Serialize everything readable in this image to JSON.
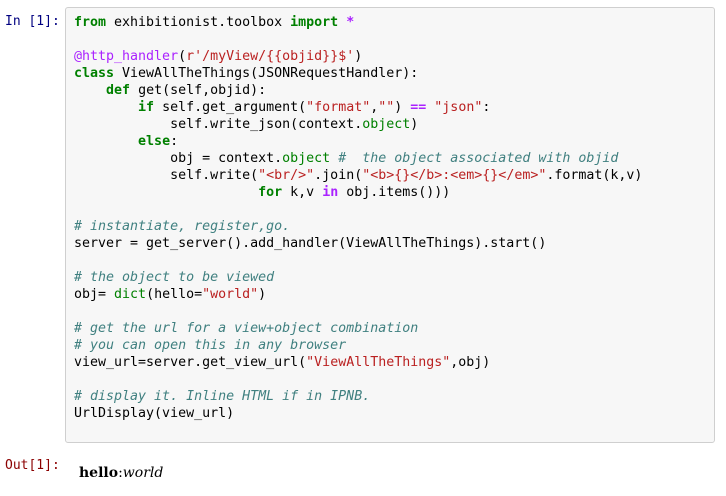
{
  "cell": {
    "in_prompt": "In [1]:",
    "out_prompt": "Out[1]:",
    "code_lines": [
      [
        [
          "kw",
          "from"
        ],
        [
          "plain",
          " exhibitionist.toolbox "
        ],
        [
          "kw",
          "import"
        ],
        [
          "plain",
          " "
        ],
        [
          "op",
          "*"
        ]
      ],
      [],
      [
        [
          "dec",
          "@http_handler"
        ],
        [
          "plain",
          "("
        ],
        [
          "str",
          "r'/myView/{{objid}}$'"
        ],
        [
          "plain",
          ")"
        ]
      ],
      [
        [
          "kw",
          "class"
        ],
        [
          "plain",
          " ViewAllTheThings(JSONRequestHandler):"
        ]
      ],
      [
        [
          "plain",
          "    "
        ],
        [
          "kw",
          "def"
        ],
        [
          "plain",
          " get(self,objid):"
        ]
      ],
      [
        [
          "plain",
          "        "
        ],
        [
          "kw",
          "if"
        ],
        [
          "plain",
          " self.get_argument("
        ],
        [
          "str",
          "\"format\""
        ],
        [
          "plain",
          ","
        ],
        [
          "str",
          "\"\""
        ],
        [
          "plain",
          ") "
        ],
        [
          "op",
          "=="
        ],
        [
          "plain",
          " "
        ],
        [
          "str",
          "\"json\""
        ],
        [
          "plain",
          ":"
        ]
      ],
      [
        [
          "plain",
          "            self.write_json(context."
        ],
        [
          "kwn",
          "object"
        ],
        [
          "plain",
          ")"
        ]
      ],
      [
        [
          "plain",
          "        "
        ],
        [
          "kw",
          "else"
        ],
        [
          "plain",
          ":"
        ]
      ],
      [
        [
          "plain",
          "            obj = context."
        ],
        [
          "kwn",
          "object"
        ],
        [
          "plain",
          " "
        ],
        [
          "cm",
          "#  the object associated with objid"
        ]
      ],
      [
        [
          "plain",
          "            self.write("
        ],
        [
          "str",
          "\"<br/>\""
        ],
        [
          "plain",
          ".join("
        ],
        [
          "str",
          "\"<b>{}</b>:<em>{}</em>\""
        ],
        [
          "plain",
          ".format(k,v)"
        ]
      ],
      [
        [
          "plain",
          "                       "
        ],
        [
          "kw",
          "for"
        ],
        [
          "plain",
          " k,v "
        ],
        [
          "op",
          "in"
        ],
        [
          "plain",
          " obj.items()))"
        ]
      ],
      [],
      [
        [
          "cm",
          "# instantiate, register,go."
        ]
      ],
      [
        [
          "plain",
          "server = get_server().add_handler(ViewAllTheThings).start()"
        ]
      ],
      [],
      [
        [
          "cm",
          "# the object to be viewed"
        ]
      ],
      [
        [
          "plain",
          "obj= "
        ],
        [
          "bi",
          "dict"
        ],
        [
          "plain",
          "(hello="
        ],
        [
          "str",
          "\"world\""
        ],
        [
          "plain",
          ")"
        ]
      ],
      [],
      [
        [
          "cm",
          "# get the url for a view+object combination"
        ]
      ],
      [
        [
          "cm",
          "# you can open this in any browser"
        ]
      ],
      [
        [
          "plain",
          "view_url=server.get_view_url("
        ],
        [
          "str",
          "\"ViewAllTheThings\""
        ],
        [
          "plain",
          ",obj)"
        ]
      ],
      [],
      [
        [
          "cm",
          "# display it. Inline HTML if in IPNB."
        ]
      ],
      [
        [
          "plain",
          "UrlDisplay(view_url)"
        ]
      ]
    ]
  },
  "output": {
    "key": "hello",
    "separator": ":",
    "value": "world"
  }
}
